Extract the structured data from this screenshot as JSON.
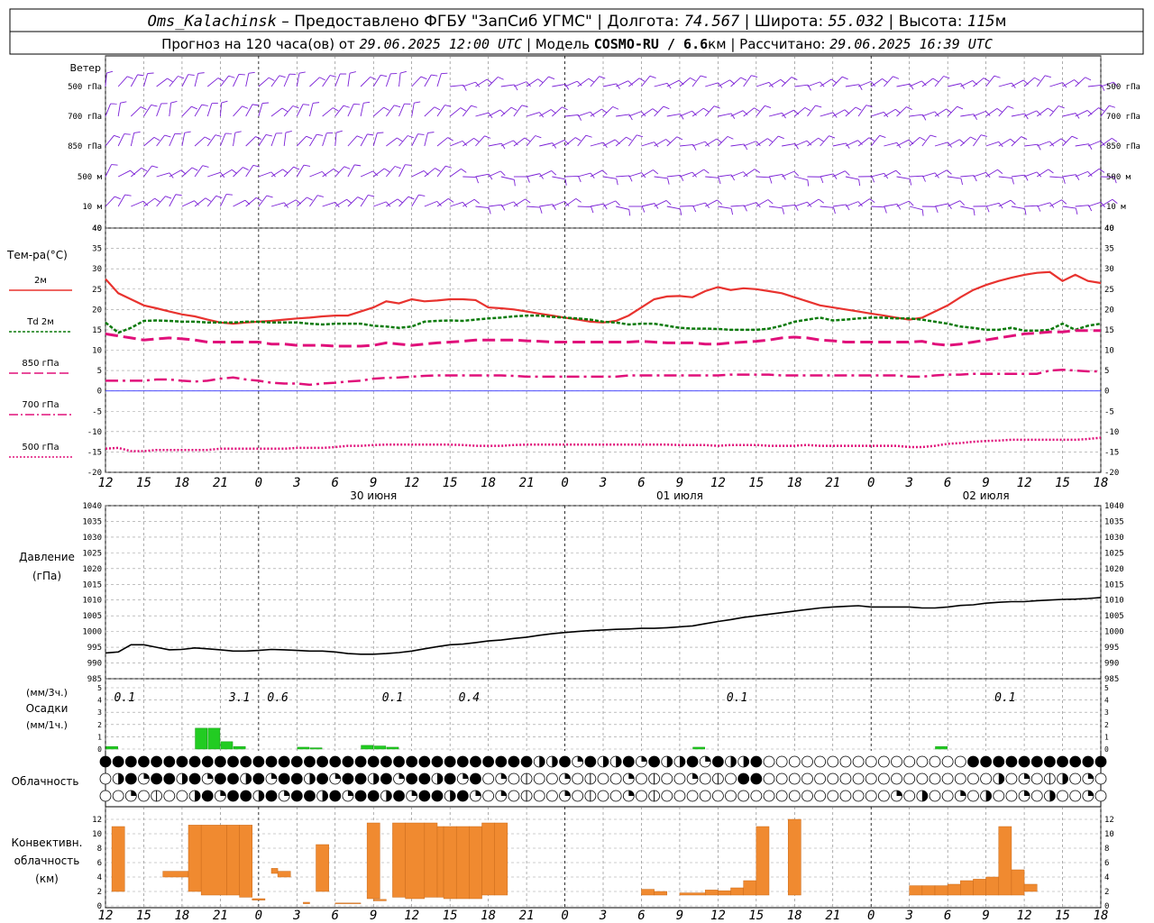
{
  "header": {
    "station": "Oms_Kalachinsk",
    "dash": "–",
    "provider": "Предоставлено ФГБУ \"ЗапСиб УГМС\"",
    "lon_label": "Долгота:",
    "lon_value": "74.567",
    "lat_label": "Широта:",
    "lat_value": "55.032",
    "alt_label": "Высота:",
    "alt_value": "115",
    "alt_unit": "м",
    "forecast_prefix": "Прогноз на 120 часа(ов) от",
    "forecast_start": "29.06.2025 12:00 UTC",
    "model_label": "| Модель",
    "model_name": "COSMO-RU / 6.6",
    "model_unit": "км",
    "calc_label": "| Рассчитано:",
    "calc_time": "29.06.2025 16:39 UTC"
  },
  "time_axis": {
    "hour_labels": [
      "12",
      "15",
      "18",
      "21",
      "0",
      "3",
      "6",
      "9",
      "12",
      "15",
      "18",
      "21",
      "0",
      "3",
      "6",
      "9",
      "12",
      "15",
      "18",
      "21",
      "0",
      "3",
      "6",
      "9",
      "12",
      "15",
      "18"
    ],
    "date_labels": [
      {
        "label": "30 июня",
        "hour": 21
      },
      {
        "label": "01 июля",
        "hour": 45
      },
      {
        "label": "02 июля",
        "hour": 69
      }
    ]
  },
  "colors": {
    "t2m": "#e8332f",
    "td2m": "#0b7a0b",
    "t850": "#e0107a",
    "t700": "#e0107a",
    "t500": "#e0107a",
    "wind": "#7a1fd6",
    "precip": "#22cc22",
    "conv": "#f08a30",
    "zero_line": "#3333ff"
  },
  "wind_panel": {
    "title": "Ветер",
    "levels": [
      "500 гПа",
      "700 гПа",
      "850 гПа",
      "500 м",
      "10   м"
    ]
  },
  "temp_panel": {
    "title": "Тем-ра(°C)",
    "legend": [
      {
        "label": "2м"
      },
      {
        "label": "Td  2м"
      },
      {
        "label": "850 гПа"
      },
      {
        "label": "700 гПа"
      },
      {
        "label": "500 гПа"
      }
    ],
    "ticks": [
      "40",
      "35",
      "30",
      "25",
      "20",
      "15",
      "10",
      "5",
      "0",
      "-5",
      "-10",
      "-15",
      "-20"
    ]
  },
  "pressure_panel": {
    "title": "Давление",
    "unit": "(гПа)",
    "ticks": [
      "1040",
      "1035",
      "1030",
      "1025",
      "1020",
      "1015",
      "1010",
      "1005",
      "1000",
      "995",
      "990",
      "985"
    ]
  },
  "precip_panel": {
    "unit_top": "(мм/3ч.)",
    "title": "Осадки",
    "unit_bottom": "(мм/1ч.)",
    "ticks": [
      "5",
      "4",
      "3",
      "2",
      "1",
      "0"
    ],
    "totals": [
      {
        "value": "0.1",
        "hour": 1.5
      },
      {
        "value": "3.1",
        "hour": 10.5
      },
      {
        "value": "0.6",
        "hour": 13.5
      },
      {
        "value": "0.1",
        "hour": 22.5
      },
      {
        "value": "0.4",
        "hour": 28.5
      },
      {
        "value": "0.1",
        "hour": 49.5
      },
      {
        "value": "0.1",
        "hour": 70.5
      }
    ]
  },
  "cloud_panel": {
    "title": "Облачность"
  },
  "conv_panel": {
    "title_1": "Конвективн.",
    "title_2": "облачность",
    "unit": "(км)",
    "ticks": [
      "12",
      "10",
      "8",
      "6",
      "4",
      "2",
      "0"
    ]
  },
  "chart_data": {
    "type": "line",
    "x_hours_from_start": [
      0,
      1,
      2,
      3,
      4,
      5,
      6,
      7,
      8,
      9,
      10,
      11,
      12,
      13,
      14,
      15,
      16,
      17,
      18,
      19,
      20,
      21,
      22,
      23,
      24,
      25,
      26,
      27,
      28,
      29,
      30,
      31,
      32,
      33,
      34,
      35,
      36,
      37,
      38,
      39,
      40,
      41,
      42,
      43,
      44,
      45,
      46,
      47,
      48,
      49,
      50,
      51,
      52,
      53,
      54,
      55,
      56,
      57,
      58,
      59,
      60,
      61,
      62,
      63,
      64,
      65,
      66,
      67,
      68,
      69,
      70,
      71,
      72,
      73,
      74,
      75,
      76,
      77,
      78
    ],
    "temp_ylim": [
      -20,
      40
    ],
    "pressure_ylim": [
      985,
      1040
    ],
    "precip_ylim": [
      0,
      5
    ],
    "conv_ylim": [
      0,
      13
    ],
    "series": [
      {
        "name": "2м",
        "values": [
          27.5,
          24,
          22.5,
          21,
          20.3,
          19.5,
          18.8,
          18.3,
          17.5,
          16.8,
          16.5,
          16.8,
          17.0,
          17.2,
          17.5,
          17.8,
          18,
          18.3,
          18.5,
          18.5,
          19.5,
          20.5,
          22,
          21.5,
          22.5,
          22,
          22.2,
          22.5,
          22.5,
          22.3,
          20.5,
          20.3,
          20,
          19.5,
          19,
          18.5,
          18,
          17.5,
          17,
          16.8,
          17.2,
          18.5,
          20.5,
          22.5,
          23.2,
          23.3,
          23,
          24.5,
          25.5,
          24.8,
          25.2,
          25.0,
          24.5,
          24,
          23,
          22,
          21,
          20.5,
          20.0,
          19.5,
          19,
          18.5,
          18,
          17.5,
          18.0,
          19.5,
          21,
          23,
          24.8,
          26,
          27,
          27.8,
          28.5,
          29,
          29.2,
          27,
          28.5,
          27,
          26.5
        ]
      },
      {
        "name": "Td 2м",
        "values": [
          16.8,
          14.3,
          15.5,
          17.2,
          17.3,
          17.2,
          17.0,
          17.0,
          16.8,
          16.8,
          16.8,
          17.0,
          17.0,
          16.8,
          16.8,
          16.8,
          16.5,
          16.3,
          16.5,
          16.5,
          16.5,
          16.0,
          15.8,
          15.5,
          15.8,
          17,
          17.2,
          17.3,
          17.2,
          17.5,
          17.8,
          18.0,
          18.3,
          18.5,
          18.5,
          18.2,
          18.0,
          17.8,
          17.5,
          17,
          16.8,
          16.3,
          16.5,
          16.5,
          16.0,
          15.5,
          15.3,
          15.3,
          15.2,
          15.0,
          15.0,
          15.0,
          15.3,
          16,
          17,
          17.5,
          18.0,
          17.3,
          17.5,
          17.8,
          18.0,
          18,
          17.8,
          17.8,
          17.5,
          17.0,
          16.5,
          15.8,
          15.5,
          15,
          15,
          15.5,
          14.8,
          14.8,
          15,
          16.5,
          15,
          16,
          16.5
        ]
      },
      {
        "name": "850 гПа",
        "values": [
          14,
          13.5,
          13,
          12.5,
          12.8,
          13,
          12.8,
          12.5,
          12.0,
          12.0,
          12.0,
          12.0,
          12.0,
          11.5,
          11.5,
          11.2,
          11.2,
          11.2,
          11.0,
          11.0,
          11.0,
          11.2,
          11.8,
          11.5,
          11.2,
          11.5,
          11.8,
          12.0,
          12.2,
          12.5,
          12.5,
          12.5,
          12.5,
          12.3,
          12.2,
          12.0,
          12.0,
          12.0,
          12.0,
          12.0,
          12.0,
          12.0,
          12.2,
          12.0,
          11.8,
          11.8,
          11.8,
          11.5,
          11.5,
          11.8,
          12.0,
          12.2,
          12.5,
          13.0,
          13.2,
          13.0,
          12.5,
          12.3,
          12.0,
          12.0,
          12.0,
          12.0,
          12.0,
          12.0,
          12.2,
          11.5,
          11.2,
          11.5,
          12.0,
          12.5,
          13.0,
          13.5,
          14.0,
          14.2,
          14.5,
          14.5,
          14.8,
          14.8,
          14.8
        ]
      },
      {
        "name": "700 гПа",
        "values": [
          2.5,
          2.5,
          2.5,
          2.5,
          2.8,
          2.8,
          2.5,
          2.3,
          2.5,
          3.0,
          3.3,
          2.8,
          2.5,
          2.0,
          1.8,
          1.8,
          1.5,
          1.8,
          2.0,
          2.3,
          2.5,
          3.0,
          3.2,
          3.3,
          3.5,
          3.7,
          3.8,
          3.8,
          3.8,
          3.8,
          3.8,
          3.8,
          3.7,
          3.5,
          3.5,
          3.5,
          3.5,
          3.5,
          3.5,
          3.5,
          3.5,
          3.8,
          3.8,
          3.8,
          3.8,
          3.8,
          3.8,
          3.8,
          3.8,
          4.0,
          4.0,
          4.0,
          4.0,
          3.8,
          3.8,
          3.8,
          3.8,
          3.8,
          3.8,
          3.8,
          3.8,
          3.8,
          3.8,
          3.5,
          3.5,
          3.8,
          4.0,
          4.0,
          4.2,
          4.2,
          4.2,
          4.2,
          4.2,
          4.2,
          5.0,
          5.2,
          5.0,
          4.8,
          4.8
        ]
      },
      {
        "name": "500 гПа",
        "values": [
          -14.2,
          -14,
          -14.8,
          -14.8,
          -14.5,
          -14.5,
          -14.5,
          -14.5,
          -14.5,
          -14.2,
          -14.2,
          -14.2,
          -14.2,
          -14.2,
          -14.2,
          -14.0,
          -14.0,
          -14.0,
          -13.8,
          -13.5,
          -13.5,
          -13.3,
          -13.2,
          -13.2,
          -13.2,
          -13.2,
          -13.2,
          -13.2,
          -13.3,
          -13.5,
          -13.5,
          -13.5,
          -13.3,
          -13.2,
          -13.2,
          -13.2,
          -13.2,
          -13.2,
          -13.2,
          -13.2,
          -13.2,
          -13.2,
          -13.2,
          -13.2,
          -13.2,
          -13.3,
          -13.3,
          -13.3,
          -13.5,
          -13.3,
          -13.3,
          -13.3,
          -13.5,
          -13.5,
          -13.5,
          -13.3,
          -13.5,
          -13.5,
          -13.5,
          -13.5,
          -13.5,
          -13.5,
          -13.5,
          -13.8,
          -13.8,
          -13.5,
          -13.0,
          -12.8,
          -12.5,
          -12.3,
          -12.2,
          -12.0,
          -12.0,
          -12.0,
          -12.0,
          -12.0,
          -12.0,
          -11.8,
          -11.5
        ]
      },
      {
        "name": "Давление",
        "values": [
          993.2,
          993.5,
          995.8,
          995.8,
          995.0,
          994.2,
          994.3,
          994.8,
          994.5,
          994.2,
          993.8,
          993.8,
          994.0,
          994.3,
          994.2,
          994.0,
          993.8,
          993.8,
          993.5,
          993.0,
          992.8,
          992.8,
          993.0,
          993.3,
          993.8,
          994.5,
          995.2,
          995.8,
          996.0,
          996.5,
          997.0,
          997.3,
          997.8,
          998.2,
          998.8,
          999.3,
          999.7,
          1000.0,
          1000.3,
          1000.5,
          1000.7,
          1000.8,
          1001.0,
          1001.0,
          1001.2,
          1001.5,
          1001.8,
          1002.5,
          1003.2,
          1003.8,
          1004.5,
          1005.0,
          1005.5,
          1006.0,
          1006.5,
          1007.0,
          1007.5,
          1007.8,
          1008.0,
          1008.2,
          1007.8,
          1007.8,
          1007.8,
          1007.8,
          1007.5,
          1007.5,
          1007.8,
          1008.3,
          1008.5,
          1009.0,
          1009.3,
          1009.5,
          1009.5,
          1009.8,
          1010.0,
          1010.2,
          1010.3,
          1010.5,
          1010.8
        ]
      }
    ],
    "precip_hourly": [
      0.2,
      0,
      0,
      0,
      0,
      0,
      0,
      1.7,
      1.7,
      0.6,
      0.2,
      0,
      0,
      0,
      0,
      0.15,
      0.1,
      0,
      0,
      0,
      0.3,
      0.25,
      0.15,
      0,
      0,
      0,
      0,
      0,
      0,
      0,
      0,
      0,
      0,
      0,
      0,
      0,
      0,
      0,
      0,
      0,
      0,
      0,
      0,
      0,
      0,
      0,
      0.15,
      0,
      0,
      0,
      0,
      0,
      0,
      0,
      0,
      0,
      0,
      0,
      0,
      0,
      0,
      0,
      0,
      0,
      0,
      0.2,
      0,
      0,
      0,
      0,
      0,
      0,
      0,
      0,
      0,
      0,
      0,
      0,
      0
    ],
    "conv_cloud_km": [
      {
        "h0": 0.5,
        "h1": 1.5,
        "base": 2.0,
        "top": 11.0
      },
      {
        "h0": 4.5,
        "h1": 6.5,
        "base": 4.0,
        "top": 4.8
      },
      {
        "h0": 6.5,
        "h1": 7.5,
        "base": 2.0,
        "top": 11.2
      },
      {
        "h0": 7.5,
        "h1": 9.5,
        "base": 1.5,
        "top": 11.2
      },
      {
        "h0": 9.5,
        "h1": 10.5,
        "base": 1.5,
        "top": 11.2
      },
      {
        "h0": 10.5,
        "h1": 11.5,
        "base": 1.2,
        "top": 11.2
      },
      {
        "h0": 11.5,
        "h1": 12.5,
        "base": 0.8,
        "top": 1.0
      },
      {
        "h0": 13.0,
        "h1": 13.5,
        "base": 4.5,
        "top": 5.2
      },
      {
        "h0": 13.5,
        "h1": 14.5,
        "base": 4.0,
        "top": 4.8
      },
      {
        "h0": 15.5,
        "h1": 16.0,
        "base": 0.3,
        "top": 0.5
      },
      {
        "h0": 16.5,
        "h1": 17.5,
        "base": 2.0,
        "top": 8.5
      },
      {
        "h0": 18.0,
        "h1": 20.0,
        "base": 0.3,
        "top": 0.4
      },
      {
        "h0": 20.5,
        "h1": 21.5,
        "base": 1.0,
        "top": 11.5
      },
      {
        "h0": 21.0,
        "h1": 22.0,
        "base": 0.7,
        "top": 0.9
      },
      {
        "h0": 22.5,
        "h1": 23.5,
        "base": 1.2,
        "top": 11.5
      },
      {
        "h0": 23.5,
        "h1": 25.0,
        "base": 1.0,
        "top": 11.5
      },
      {
        "h0": 25.0,
        "h1": 26.0,
        "base": 1.2,
        "top": 11.5
      },
      {
        "h0": 26.0,
        "h1": 26.5,
        "base": 1.2,
        "top": 11.0
      },
      {
        "h0": 26.5,
        "h1": 27.5,
        "base": 1.0,
        "top": 11.0
      },
      {
        "h0": 27.5,
        "h1": 28.5,
        "base": 1.0,
        "top": 11.0
      },
      {
        "h0": 28.5,
        "h1": 29.5,
        "base": 1.0,
        "top": 11.0
      },
      {
        "h0": 29.5,
        "h1": 30.5,
        "base": 1.5,
        "top": 11.5
      },
      {
        "h0": 30.5,
        "h1": 31.5,
        "base": 1.5,
        "top": 11.5
      },
      {
        "h0": 42.0,
        "h1": 43.0,
        "base": 1.5,
        "top": 2.3
      },
      {
        "h0": 43.0,
        "h1": 44.0,
        "base": 1.5,
        "top": 2.0
      },
      {
        "h0": 45.0,
        "h1": 47.0,
        "base": 1.5,
        "top": 1.8
      },
      {
        "h0": 47.0,
        "h1": 48.0,
        "base": 1.5,
        "top": 2.2
      },
      {
        "h0": 48.0,
        "h1": 49.0,
        "base": 1.5,
        "top": 2.1
      },
      {
        "h0": 49.0,
        "h1": 50.0,
        "base": 1.5,
        "top": 2.5
      },
      {
        "h0": 50.0,
        "h1": 51.0,
        "base": 1.5,
        "top": 3.5
      },
      {
        "h0": 51.0,
        "h1": 52.0,
        "base": 1.5,
        "top": 11.0
      },
      {
        "h0": 53.5,
        "h1": 54.5,
        "base": 1.5,
        "top": 12.0
      },
      {
        "h0": 63.0,
        "h1": 64.0,
        "base": 1.5,
        "top": 2.8
      },
      {
        "h0": 64.0,
        "h1": 65.0,
        "base": 1.5,
        "top": 2.8
      },
      {
        "h0": 65.0,
        "h1": 66.0,
        "base": 1.5,
        "top": 2.8
      },
      {
        "h0": 66.0,
        "h1": 67.0,
        "base": 1.5,
        "top": 3.0
      },
      {
        "h0": 67.0,
        "h1": 68.0,
        "base": 1.5,
        "top": 3.5
      },
      {
        "h0": 68.0,
        "h1": 69.0,
        "base": 1.5,
        "top": 3.7
      },
      {
        "h0": 69.0,
        "h1": 70.0,
        "base": 1.5,
        "top": 4.0
      },
      {
        "h0": 70.0,
        "h1": 71.0,
        "base": 1.5,
        "top": 11.0
      },
      {
        "h0": 71.0,
        "h1": 72.0,
        "base": 1.5,
        "top": 5.0
      },
      {
        "h0": 72.0,
        "h1": 73.0,
        "base": 2.0,
        "top": 3.0
      }
    ],
    "cloud_rows_note_free": true,
    "cloud_rows": [
      "hhhhhhhhhhhhhhhhhhhhhhhhhhhhhhhhhhhhhhhhhhhhhhhhhhhhhhhhhhhhhhhhhhhhhhhhhhhhhhhhhhhhhhhhhhhhhhhhhhhhhhhhhhhhhh",
      "",
      ""
    ]
  }
}
